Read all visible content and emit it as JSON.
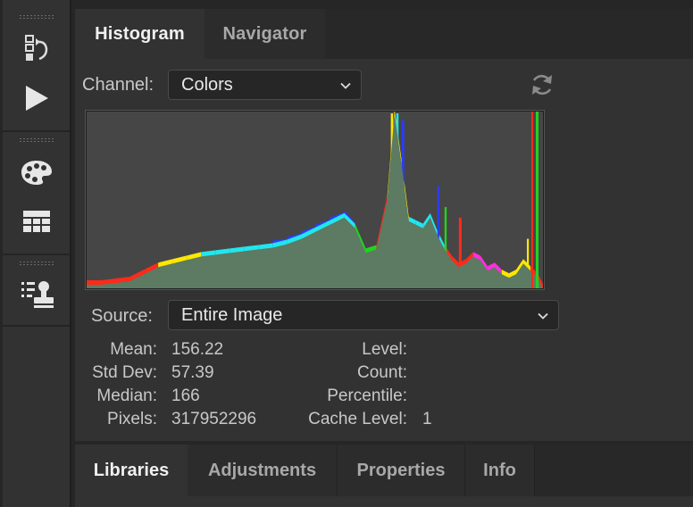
{
  "top_tabs": [
    {
      "label": "Histogram",
      "active": true
    },
    {
      "label": "Navigator",
      "active": false
    }
  ],
  "channel": {
    "label": "Channel:",
    "value": "Colors"
  },
  "source": {
    "label": "Source:",
    "value": "Entire Image"
  },
  "stats_left": [
    {
      "key": "Mean:",
      "value": "156.22"
    },
    {
      "key": "Std Dev:",
      "value": "57.39"
    },
    {
      "key": "Median:",
      "value": "166"
    },
    {
      "key": "Pixels:",
      "value": "317952296"
    }
  ],
  "stats_right": [
    {
      "key": "Level:",
      "value": ""
    },
    {
      "key": "Count:",
      "value": ""
    },
    {
      "key": "Percentile:",
      "value": ""
    },
    {
      "key": "Cache Level:",
      "value": "1"
    }
  ],
  "bottom_tabs": [
    {
      "label": "Libraries",
      "active": true
    },
    {
      "label": "Adjustments",
      "active": false
    },
    {
      "label": "Properties",
      "active": false
    },
    {
      "label": "Info",
      "active": false
    }
  ],
  "tool_icons": [
    "history-icon",
    "play-actions-icon",
    "color-palette-icon",
    "swatches-grid-icon",
    "clone-source-icon"
  ],
  "colors": {
    "panel_bg": "#323232",
    "tabbar_bg": "#282828",
    "histogram_fill": "#5d7a63",
    "histogram_bg": "#464646"
  },
  "chart_data": {
    "type": "area",
    "x_range": [
      0,
      255
    ],
    "luminosity": [
      [
        0,
        2
      ],
      [
        8,
        2
      ],
      [
        16,
        3
      ],
      [
        24,
        4
      ],
      [
        32,
        8
      ],
      [
        40,
        12
      ],
      [
        48,
        14
      ],
      [
        56,
        16
      ],
      [
        64,
        18
      ],
      [
        72,
        19
      ],
      [
        80,
        20
      ],
      [
        88,
        21
      ],
      [
        96,
        22
      ],
      [
        104,
        23
      ],
      [
        112,
        25
      ],
      [
        120,
        28
      ],
      [
        128,
        32
      ],
      [
        136,
        36
      ],
      [
        144,
        40
      ],
      [
        150,
        34
      ],
      [
        156,
        20
      ],
      [
        162,
        22
      ],
      [
        168,
        50
      ],
      [
        172,
        99
      ],
      [
        176,
        70
      ],
      [
        180,
        38
      ],
      [
        184,
        36
      ],
      [
        188,
        34
      ],
      [
        192,
        40
      ],
      [
        196,
        30
      ],
      [
        200,
        22
      ],
      [
        204,
        16
      ],
      [
        208,
        12
      ],
      [
        212,
        14
      ],
      [
        216,
        18
      ],
      [
        220,
        16
      ],
      [
        224,
        10
      ],
      [
        228,
        12
      ],
      [
        232,
        8
      ],
      [
        236,
        6
      ],
      [
        240,
        8
      ],
      [
        244,
        14
      ],
      [
        248,
        10
      ],
      [
        252,
        6
      ],
      [
        255,
        0
      ]
    ]
  }
}
